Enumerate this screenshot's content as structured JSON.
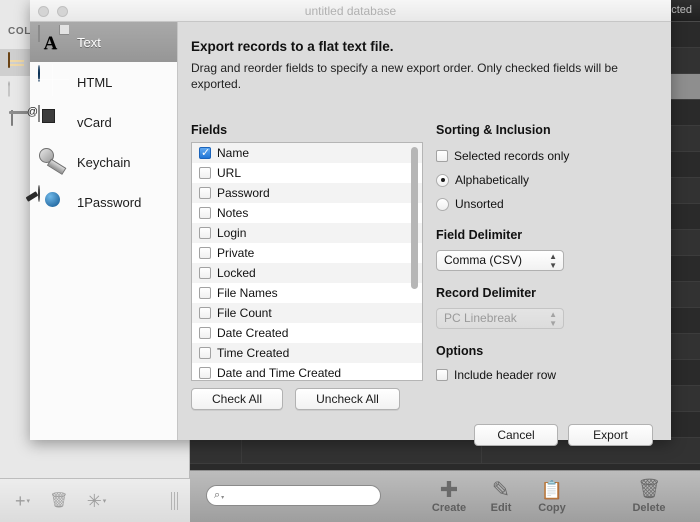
{
  "app": {
    "sidebar": {
      "header": "COLL",
      "items": [
        {
          "label": "",
          "icon": "chest-icon",
          "selected": true
        },
        {
          "label": "",
          "icon": "shirt-icon",
          "selected": false
        },
        {
          "label": "",
          "icon": "trash-icon",
          "selected": false
        }
      ]
    },
    "table": {
      "header_label": "cted"
    },
    "left_toolbar": {
      "add": "+",
      "add_caret": "▾",
      "delete": "🗑",
      "delete_caret": "",
      "settings": "✳",
      "settings_caret": "▾"
    },
    "right_toolbar": {
      "search": {
        "placeholder": "",
        "value": "",
        "icon": "search-icon",
        "caret": "▾"
      },
      "items": [
        {
          "label": "Create",
          "glyph": "✚"
        },
        {
          "label": "Edit",
          "glyph": "✎"
        },
        {
          "label": "Copy",
          "glyph": "📋"
        },
        {
          "label": "Delete",
          "glyph": "🗑"
        }
      ]
    }
  },
  "dialog": {
    "window_title": "untitled database",
    "traffic_lights": {
      "close": "close-button",
      "minimize": "minimize-button"
    },
    "formats": [
      {
        "label": "Text",
        "icon": "text-document-icon",
        "selected": true
      },
      {
        "label": "HTML",
        "icon": "globe-icon",
        "selected": false
      },
      {
        "label": "vCard",
        "icon": "vcard-icon",
        "selected": false
      },
      {
        "label": "Keychain",
        "icon": "key-icon",
        "selected": false
      },
      {
        "label": "1Password",
        "icon": "1password-icon",
        "selected": false
      }
    ],
    "title": "Export records to a flat text file.",
    "subtitle": "Drag and reorder fields to specify a new export order. Only checked fields will be exported.",
    "fields_group_title": "Fields",
    "fields": [
      {
        "label": "Name",
        "checked": true
      },
      {
        "label": "URL",
        "checked": false
      },
      {
        "label": "Password",
        "checked": false
      },
      {
        "label": "Notes",
        "checked": false
      },
      {
        "label": "Login",
        "checked": false
      },
      {
        "label": "Private",
        "checked": false
      },
      {
        "label": "Locked",
        "checked": false
      },
      {
        "label": "File Names",
        "checked": false
      },
      {
        "label": "File Count",
        "checked": false
      },
      {
        "label": "Date Created",
        "checked": false
      },
      {
        "label": "Time Created",
        "checked": false
      },
      {
        "label": "Date and Time Created",
        "checked": false
      }
    ],
    "check_all_label": "Check All",
    "uncheck_all_label": "Uncheck All",
    "sorting_group_title": "Sorting & Inclusion",
    "selected_records_only": {
      "label": "Selected records only",
      "checked": false
    },
    "sort_alphabetically": {
      "label": "Alphabetically",
      "selected": true
    },
    "sort_unsorted": {
      "label": "Unsorted",
      "selected": false
    },
    "field_delimiter_title": "Field Delimiter",
    "field_delimiter_value": "Comma (CSV)",
    "record_delimiter_title": "Record Delimiter",
    "record_delimiter_value": "PC Linebreak",
    "options_group_title": "Options",
    "include_header_row": {
      "label": "Include header row",
      "checked": false
    },
    "cancel_label": "Cancel",
    "export_label": "Export",
    "accent_color": "#2176d6"
  }
}
